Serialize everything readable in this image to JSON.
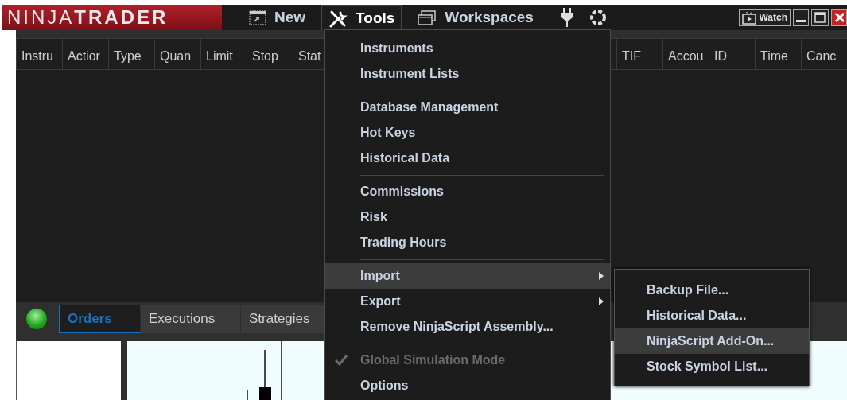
{
  "logo": "NINJA**TRADER**",
  "menu_bar": [
    {
      "kind": "new",
      "label": "New",
      "selected": false
    },
    {
      "kind": "tools",
      "label": "Tools",
      "selected": true
    },
    {
      "kind": "workspaces",
      "label": "Workspaces",
      "selected": false
    },
    {
      "kind": "plug",
      "selected": false
    },
    {
      "kind": "ring",
      "selected": false
    }
  ],
  "window_controls": {
    "watch": "Watch"
  },
  "orders_table": {
    "left_columns": [
      "Instru",
      "Actior",
      "Type",
      "Quan",
      "Limit",
      "Stop",
      "Stat"
    ],
    "right_columns": [
      "TIF",
      "Accou",
      "ID",
      "Time",
      "Canc"
    ]
  },
  "tabs": [
    {
      "label": "Orders",
      "selected": true
    },
    {
      "label": "Executions",
      "selected": false
    },
    {
      "label": "Strategies",
      "selected": false
    }
  ],
  "tools_menu": [
    {
      "kind": "item",
      "label": "Instruments",
      "selected": false
    },
    {
      "kind": "item",
      "label": "Instrument Lists",
      "selected": false
    },
    {
      "kind": "separator"
    },
    {
      "kind": "item",
      "label": "Database Management",
      "selected": false
    },
    {
      "kind": "item",
      "label": "Hot Keys",
      "selected": false
    },
    {
      "kind": "item",
      "label": "Historical Data",
      "selected": false
    },
    {
      "kind": "separator"
    },
    {
      "kind": "item",
      "label": "Commissions",
      "selected": false
    },
    {
      "kind": "item",
      "label": "Risk",
      "selected": false
    },
    {
      "kind": "item",
      "label": "Trading Hours",
      "selected": false
    },
    {
      "kind": "separator"
    },
    {
      "kind": "item",
      "label": "Import",
      "selected": true,
      "has_submenu": true
    },
    {
      "kind": "item",
      "label": "Export",
      "selected": false,
      "has_submenu": true
    },
    {
      "kind": "item",
      "label": "Remove NinjaScript Assembly...",
      "selected": false
    },
    {
      "kind": "separator"
    },
    {
      "kind": "item",
      "label": "Global Simulation Mode",
      "selected": false,
      "checked": true,
      "disabled": true
    },
    {
      "kind": "item",
      "label": "Options",
      "selected": false
    }
  ],
  "import_submenu": [
    {
      "label": "Backup File...",
      "selected": false
    },
    {
      "label": "Historical Data...",
      "selected": false
    },
    {
      "label": "NinjaScript Add-On...",
      "selected": true
    },
    {
      "label": "Stock Symbol List...",
      "selected": false
    }
  ]
}
